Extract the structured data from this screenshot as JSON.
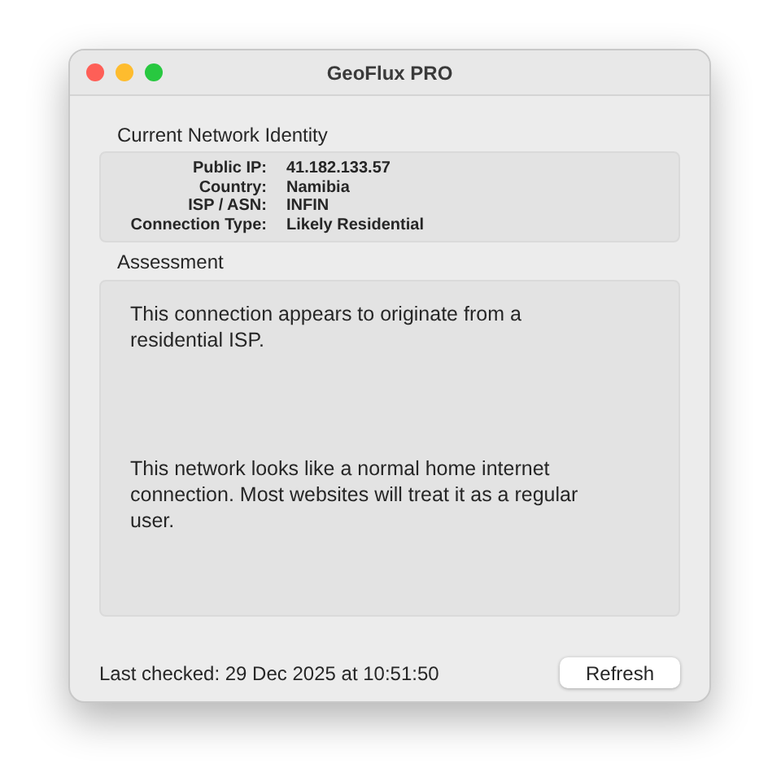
{
  "window": {
    "title": "GeoFlux PRO"
  },
  "identity": {
    "heading": "Current Network Identity",
    "rows": [
      {
        "label": "Public IP:",
        "value": "41.182.133.57"
      },
      {
        "label": "Country:",
        "value": "Namibia"
      },
      {
        "label": "ISP / ASN:",
        "value": "INFIN"
      },
      {
        "label": "Connection Type:",
        "value": "Likely Residential"
      }
    ]
  },
  "assessment": {
    "heading": "Assessment",
    "paragraphs": [
      "This connection appears to originate from a residential ISP.",
      "This network looks like a normal home internet connection. Most websites will treat it as a regular user."
    ]
  },
  "footer": {
    "last_checked": "Last checked: 29 Dec 2025 at 10:51:50",
    "button": "Refresh"
  }
}
